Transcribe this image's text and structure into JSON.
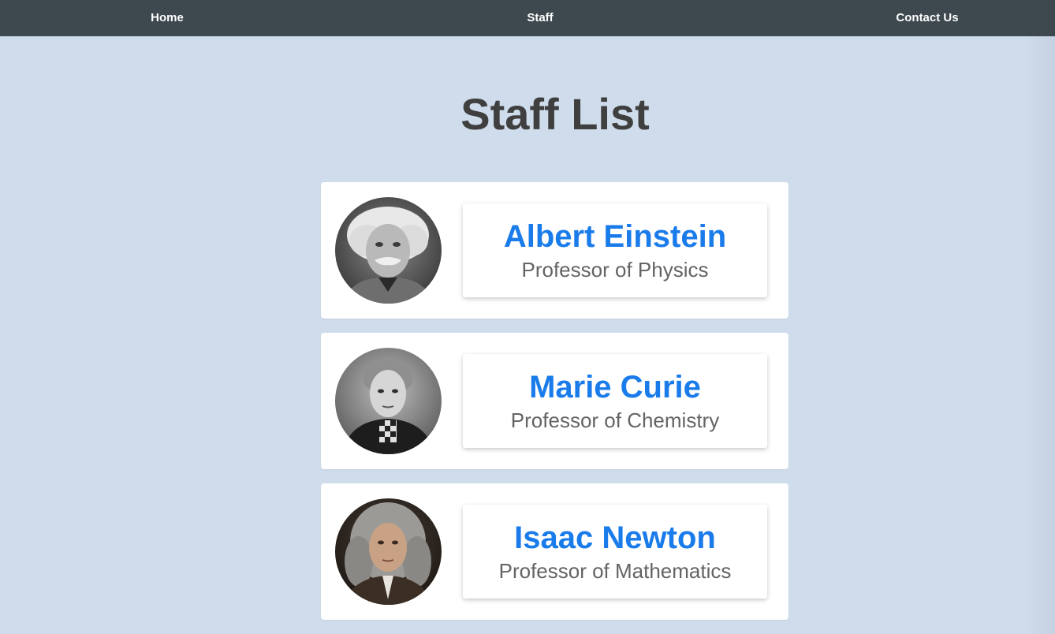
{
  "nav": {
    "home": "Home",
    "staff": "Staff",
    "contact": "Contact Us"
  },
  "page": {
    "title": "Staff List"
  },
  "staff": [
    {
      "name": "Albert Einstein",
      "role": "Professor of Physics",
      "photo_icon": "einstein-portrait"
    },
    {
      "name": "Marie Curie",
      "role": "Professor of Chemistry",
      "photo_icon": "curie-portrait"
    },
    {
      "name": "Isaac Newton",
      "role": "Professor of Mathematics",
      "photo_icon": "newton-portrait"
    }
  ],
  "colors": {
    "background": "#cfdcec",
    "navbar": "#3d484f",
    "name_accent": "#1a7bea",
    "title_text": "#3f3f3f",
    "role_text": "#646464"
  }
}
